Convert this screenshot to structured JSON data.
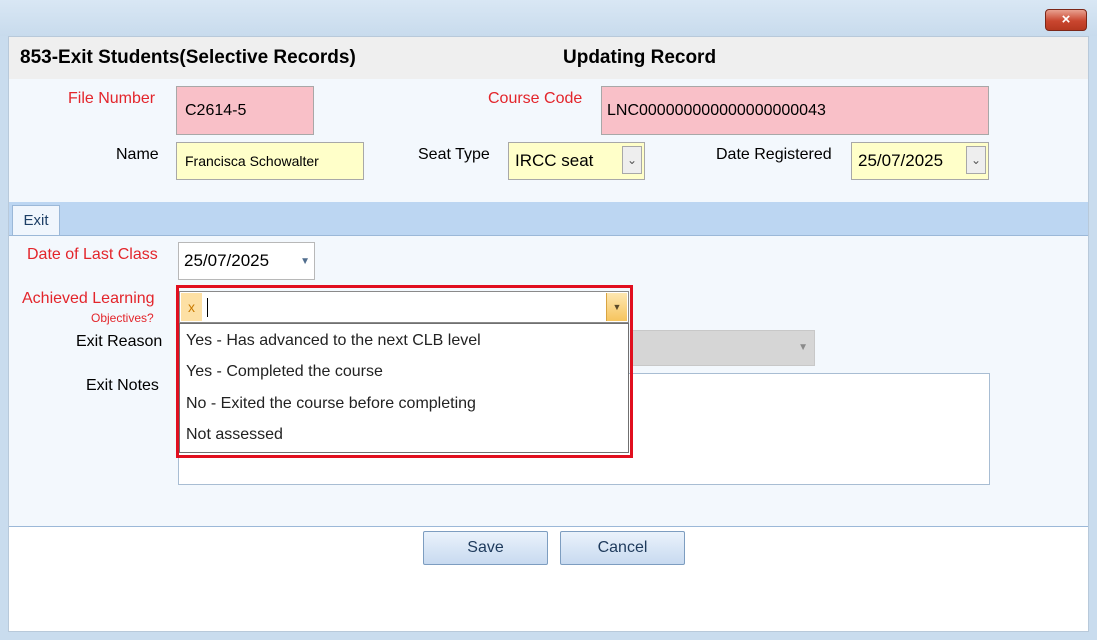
{
  "window": {
    "close_glyph": "×"
  },
  "header": {
    "title": "853-Exit Students(Selective Records)",
    "mode": "Updating Record"
  },
  "fields": {
    "file_number": {
      "label": "File Number",
      "value": "C2614-5"
    },
    "course_code": {
      "label": "Course Code",
      "value": "LNC000000000000000000043"
    },
    "name": {
      "label": "Name",
      "value": "Francisca Schowalter"
    },
    "seat_type": {
      "label": "Seat Type",
      "value": "IRCC seat"
    },
    "date_registered": {
      "label": "Date Registered",
      "value": "25/07/2025"
    }
  },
  "tabs": [
    {
      "label": "Exit"
    }
  ],
  "exit": {
    "date_last_class": {
      "label": "Date of Last Class",
      "value": "25/07/2025"
    },
    "achieved": {
      "label": "Achieved Learning",
      "label2": "Objectives?",
      "token": "x",
      "value": "",
      "options": [
        "Yes - Has advanced to the next CLB level",
        "Yes - Completed the course",
        "No - Exited the course before completing",
        "Not assessed"
      ]
    },
    "exit_reason": {
      "label": "Exit Reason",
      "value": ""
    },
    "exit_notes": {
      "label": "Exit Notes",
      "value": ""
    }
  },
  "buttons": {
    "save": "Save",
    "cancel": "Cancel"
  },
  "colors": {
    "required_label": "#e3252b",
    "highlight_border": "#e10f1f",
    "pink_field": "#f9c0c8",
    "yellow_field": "#ffffc9"
  }
}
